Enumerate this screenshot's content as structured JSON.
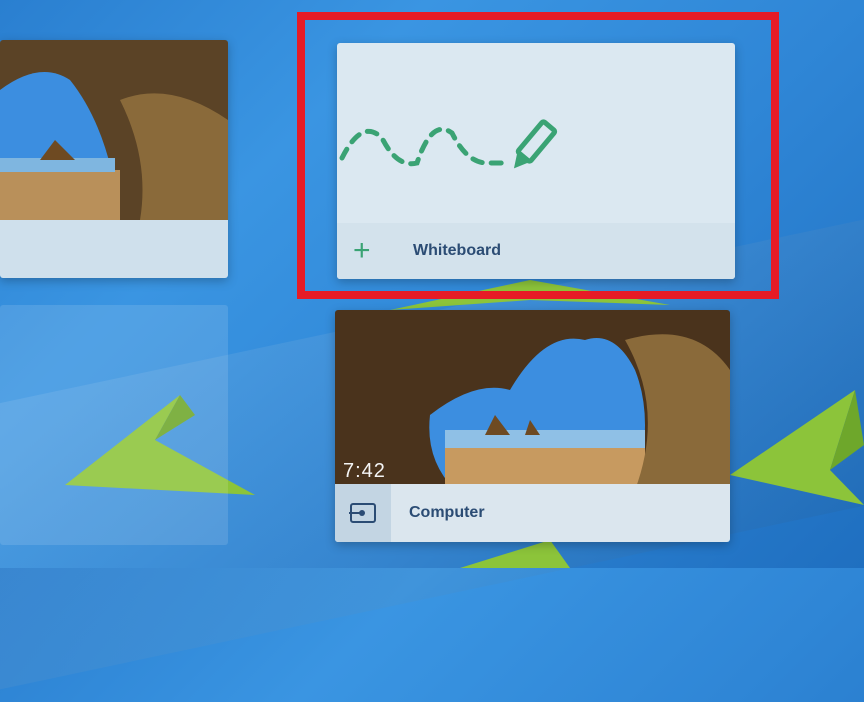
{
  "whiteboard_card": {
    "label": "Whiteboard",
    "add_icon": "plus-icon",
    "preview_icon": "pencil-squiggle-icon"
  },
  "computer_card": {
    "label": "Computer",
    "source_icon": "input-source-icon",
    "time": "7:42"
  },
  "left_card": {
    "label": ""
  },
  "colors": {
    "highlight": "#e61b26",
    "background": "#2f86d6",
    "leaf": "#8cc43a"
  }
}
